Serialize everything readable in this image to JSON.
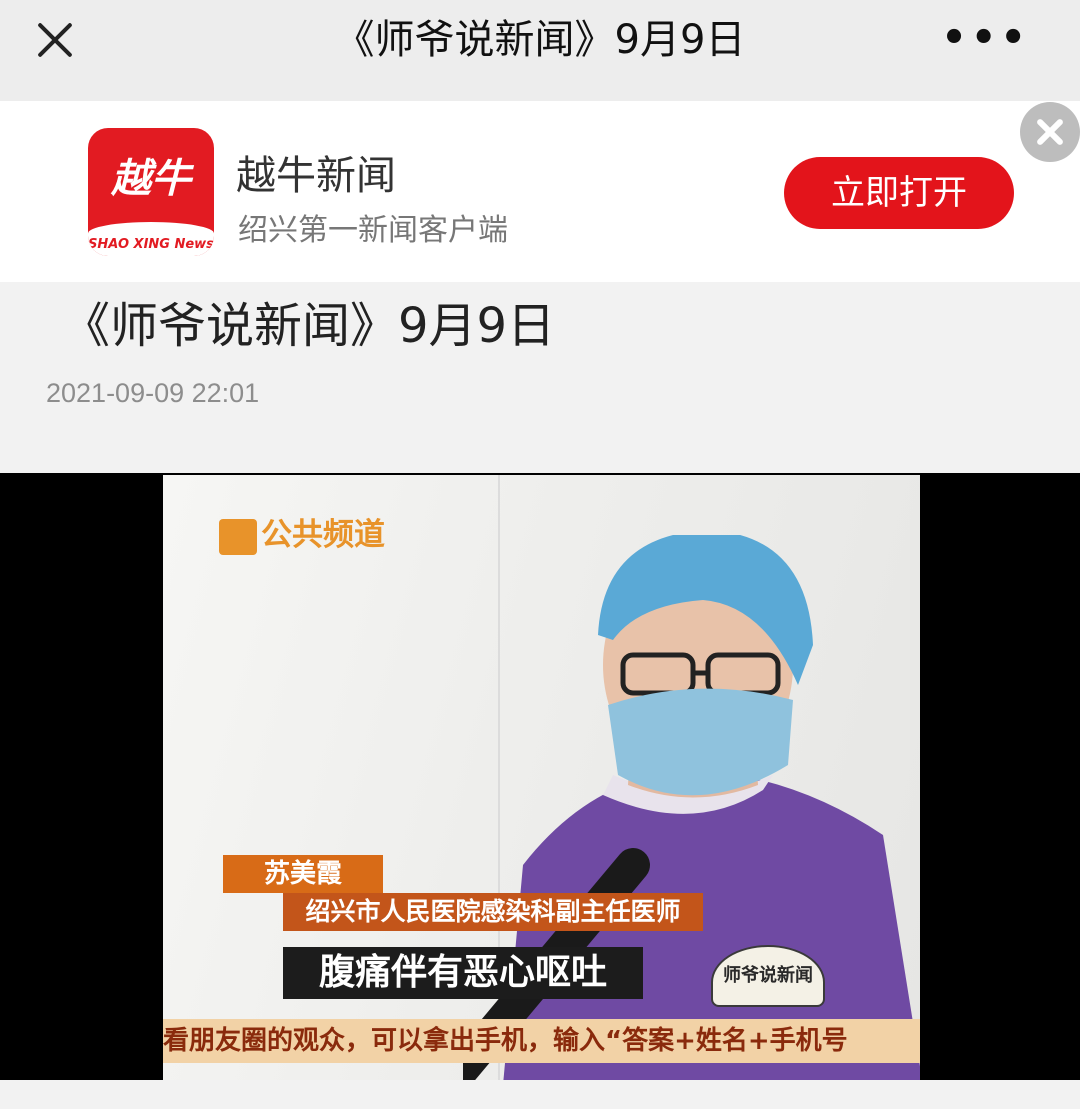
{
  "topbar": {
    "title": "《师爷说新闻》9月9日",
    "close_icon": "close-icon",
    "more_icon": "more-icon",
    "more_label": "•••"
  },
  "banner": {
    "logo_text": "越牛",
    "logo_sub": "SHAO XING News",
    "app_name": "越牛新闻",
    "tagline": "绍兴第一新闻客户端",
    "open_label": "立即打开",
    "accent_color": "#e3141b"
  },
  "article": {
    "title": "《师爷说新闻》9月9日",
    "date": "2021-09-09 22:01"
  },
  "video": {
    "channel_label": "公共频道",
    "name_tag": "苏美霞",
    "role_tag": "绍兴市人民医院感染科副主任医师",
    "subtitle": "腹痛伴有恶心呕吐",
    "stamp_text": "师爷说新闻",
    "ticker": "看朋友圈的观众，可以拿出手机，输入“答案+姓名+手机号"
  }
}
